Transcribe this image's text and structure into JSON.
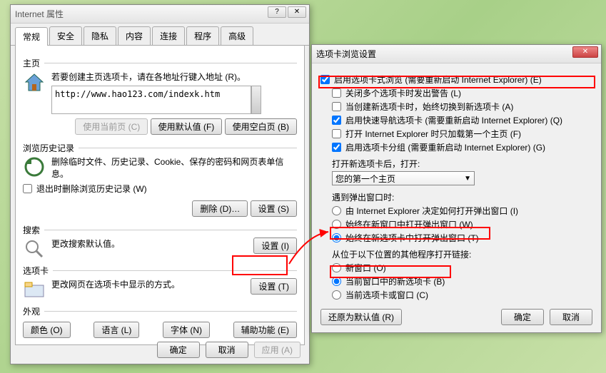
{
  "left": {
    "title": "Internet 属性",
    "tabs": [
      "常规",
      "安全",
      "隐私",
      "内容",
      "连接",
      "程序",
      "高级"
    ],
    "home": {
      "group": "主页",
      "desc": "若要创建主页选项卡，请在各地址行键入地址 (R)。",
      "url": "http://www.hao123.com/indexk.htm",
      "btn_current": "使用当前页 (C)",
      "btn_default": "使用默认值 (F)",
      "btn_blank": "使用空白页 (B)"
    },
    "history": {
      "group": "浏览历史记录",
      "desc": "删除临时文件、历史记录、Cookie、保存的密码和网页表单信息。",
      "chk": "退出时删除浏览历史记录 (W)",
      "btn_delete": "删除 (D)…",
      "btn_settings": "设置 (S)"
    },
    "search": {
      "group": "搜索",
      "desc": "更改搜索默认值。",
      "btn": "设置 (I)"
    },
    "tabs_section": {
      "group": "选项卡",
      "desc": "更改网页在选项卡中显示的方式。",
      "btn": "设置 (T)"
    },
    "appearance": {
      "group": "外观",
      "b1": "颜色 (O)",
      "b2": "语言 (L)",
      "b3": "字体 (N)",
      "b4": "辅助功能 (E)"
    },
    "ok": "确定",
    "cancel": "取消",
    "apply": "应用 (A)"
  },
  "right": {
    "title": "选项卡浏览设置",
    "c1": "启用选项卡式浏览 (需要重新启动 Internet Explorer) (E)",
    "c2": "关闭多个选项卡时发出警告 (L)",
    "c3": "当创建新选项卡时，始终切换到新选项卡 (A)",
    "c4": "启用快速导航选项卡 (需要重新启动 Internet Explorer) (Q)",
    "c5": "打开 Internet Explorer 时只加载第一个主页 (F)",
    "c6": "启用选项卡分组 (需要重新启动 Internet Explorer) (G)",
    "lbl_open": "打开新选项卡后，打开:",
    "dd_val": "您的第一个主页",
    "lbl_popup": "遇到弹出窗口时:",
    "r1": "由 Internet Explorer 决定如何打开弹出窗口 (I)",
    "r2": "始终在新窗口中打开弹出窗口 (W)",
    "r3": "始终在新选项卡中打开弹出窗口 (T)",
    "lbl_links": "从位于以下位置的其他程序打开链接:",
    "r4": "新窗口 (O)",
    "r5": "当前窗口中的新选项卡 (B)",
    "r6": "当前选项卡或窗口 (C)",
    "restore": "还原为默认值 (R)",
    "ok": "确定",
    "cancel": "取消"
  }
}
